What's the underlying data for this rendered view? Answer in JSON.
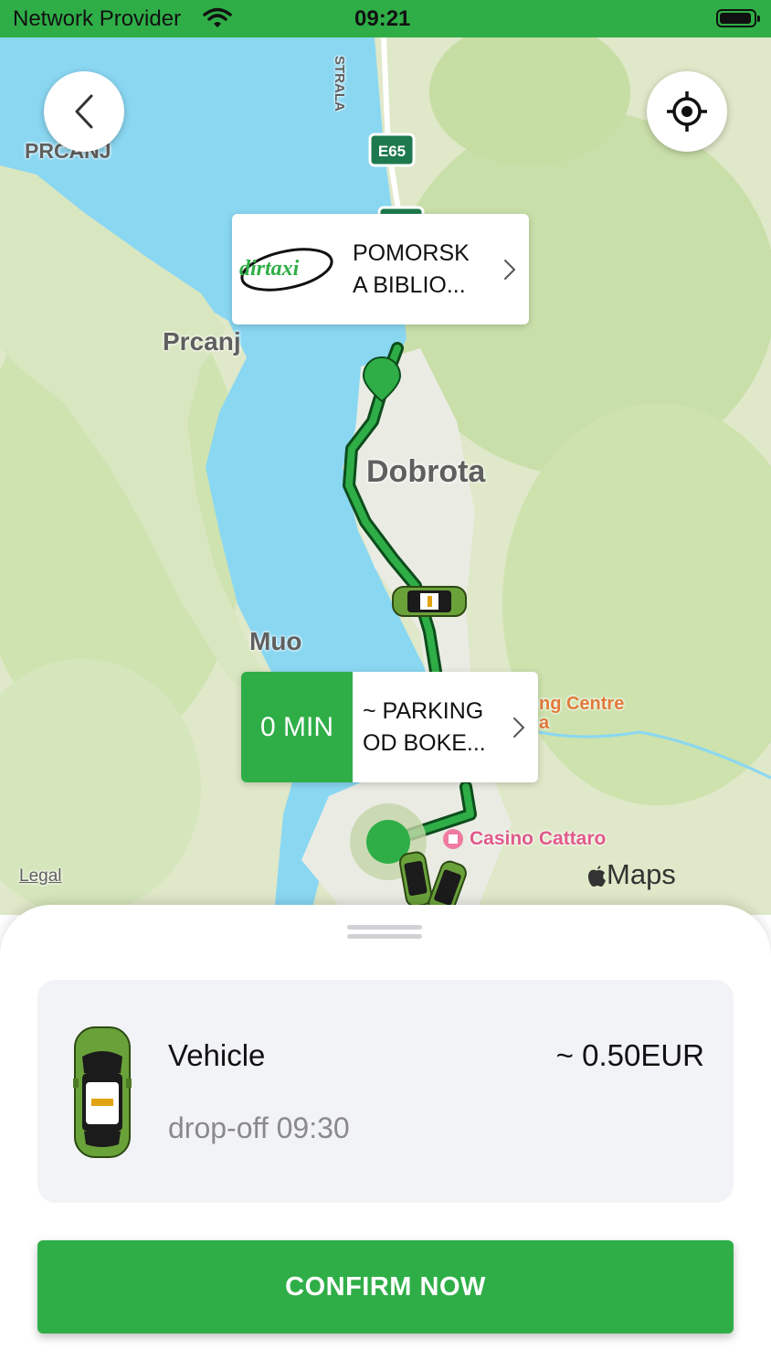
{
  "status_bar": {
    "provider": "Network Provider",
    "time": "09:21"
  },
  "map": {
    "labels": {
      "prcanj_top": "PRCANJ",
      "prcanj": "Prcanj",
      "dobrota": "Dobrota",
      "muo": "Muo",
      "shopping_centre": "ng Centre",
      "shopping_centre_2": "a",
      "casino": "Casino Cattaro",
      "legal": "Legal",
      "maps_brand": "Maps",
      "road_strala": "STRALA",
      "road_e65": "E65"
    },
    "pickup_callout": {
      "line1": "POMORSK",
      "line2": "A BIBLIO...",
      "logo_text": "dirtaxi"
    },
    "dropoff_callout": {
      "eta": "0 MIN",
      "line1": "~ PARKING",
      "line2": "OD BOKE..."
    }
  },
  "sheet": {
    "vehicle_name": "Vehicle",
    "price": "~ 0.50EUR",
    "dropoff": "drop-off 09:30",
    "confirm_label": "CONFIRM NOW"
  },
  "colors": {
    "brand_green": "#2fae47",
    "water": "#8ad7f2",
    "land": "#dfe8c8"
  }
}
